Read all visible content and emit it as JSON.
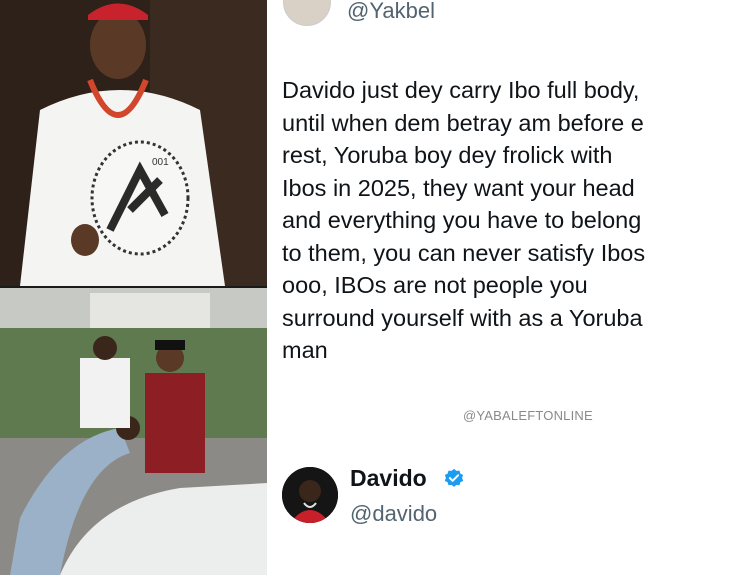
{
  "tweet": {
    "top_handle": "@Yakbel",
    "text": "Davido just dey carry Ibo full body,\nuntil when dem betray am before e\nrest, Yoruba boy dey frolick with\nIbos in 2025, they want your head\nand everything you have to belong\nto them, you can never satisfy Ibos\nooo, IBOs are not people you\nsurround yourself with as a Yoruba\nman",
    "watermark": "@YABALEFTONLINE"
  },
  "reply_author": {
    "name": "Davido",
    "handle": "@davido",
    "verified": true
  },
  "photos": {
    "top_fan_text": "001"
  },
  "colors": {
    "text": "#0f1419",
    "secondary": "#536471",
    "verified_blue": "#1d9bf0"
  }
}
